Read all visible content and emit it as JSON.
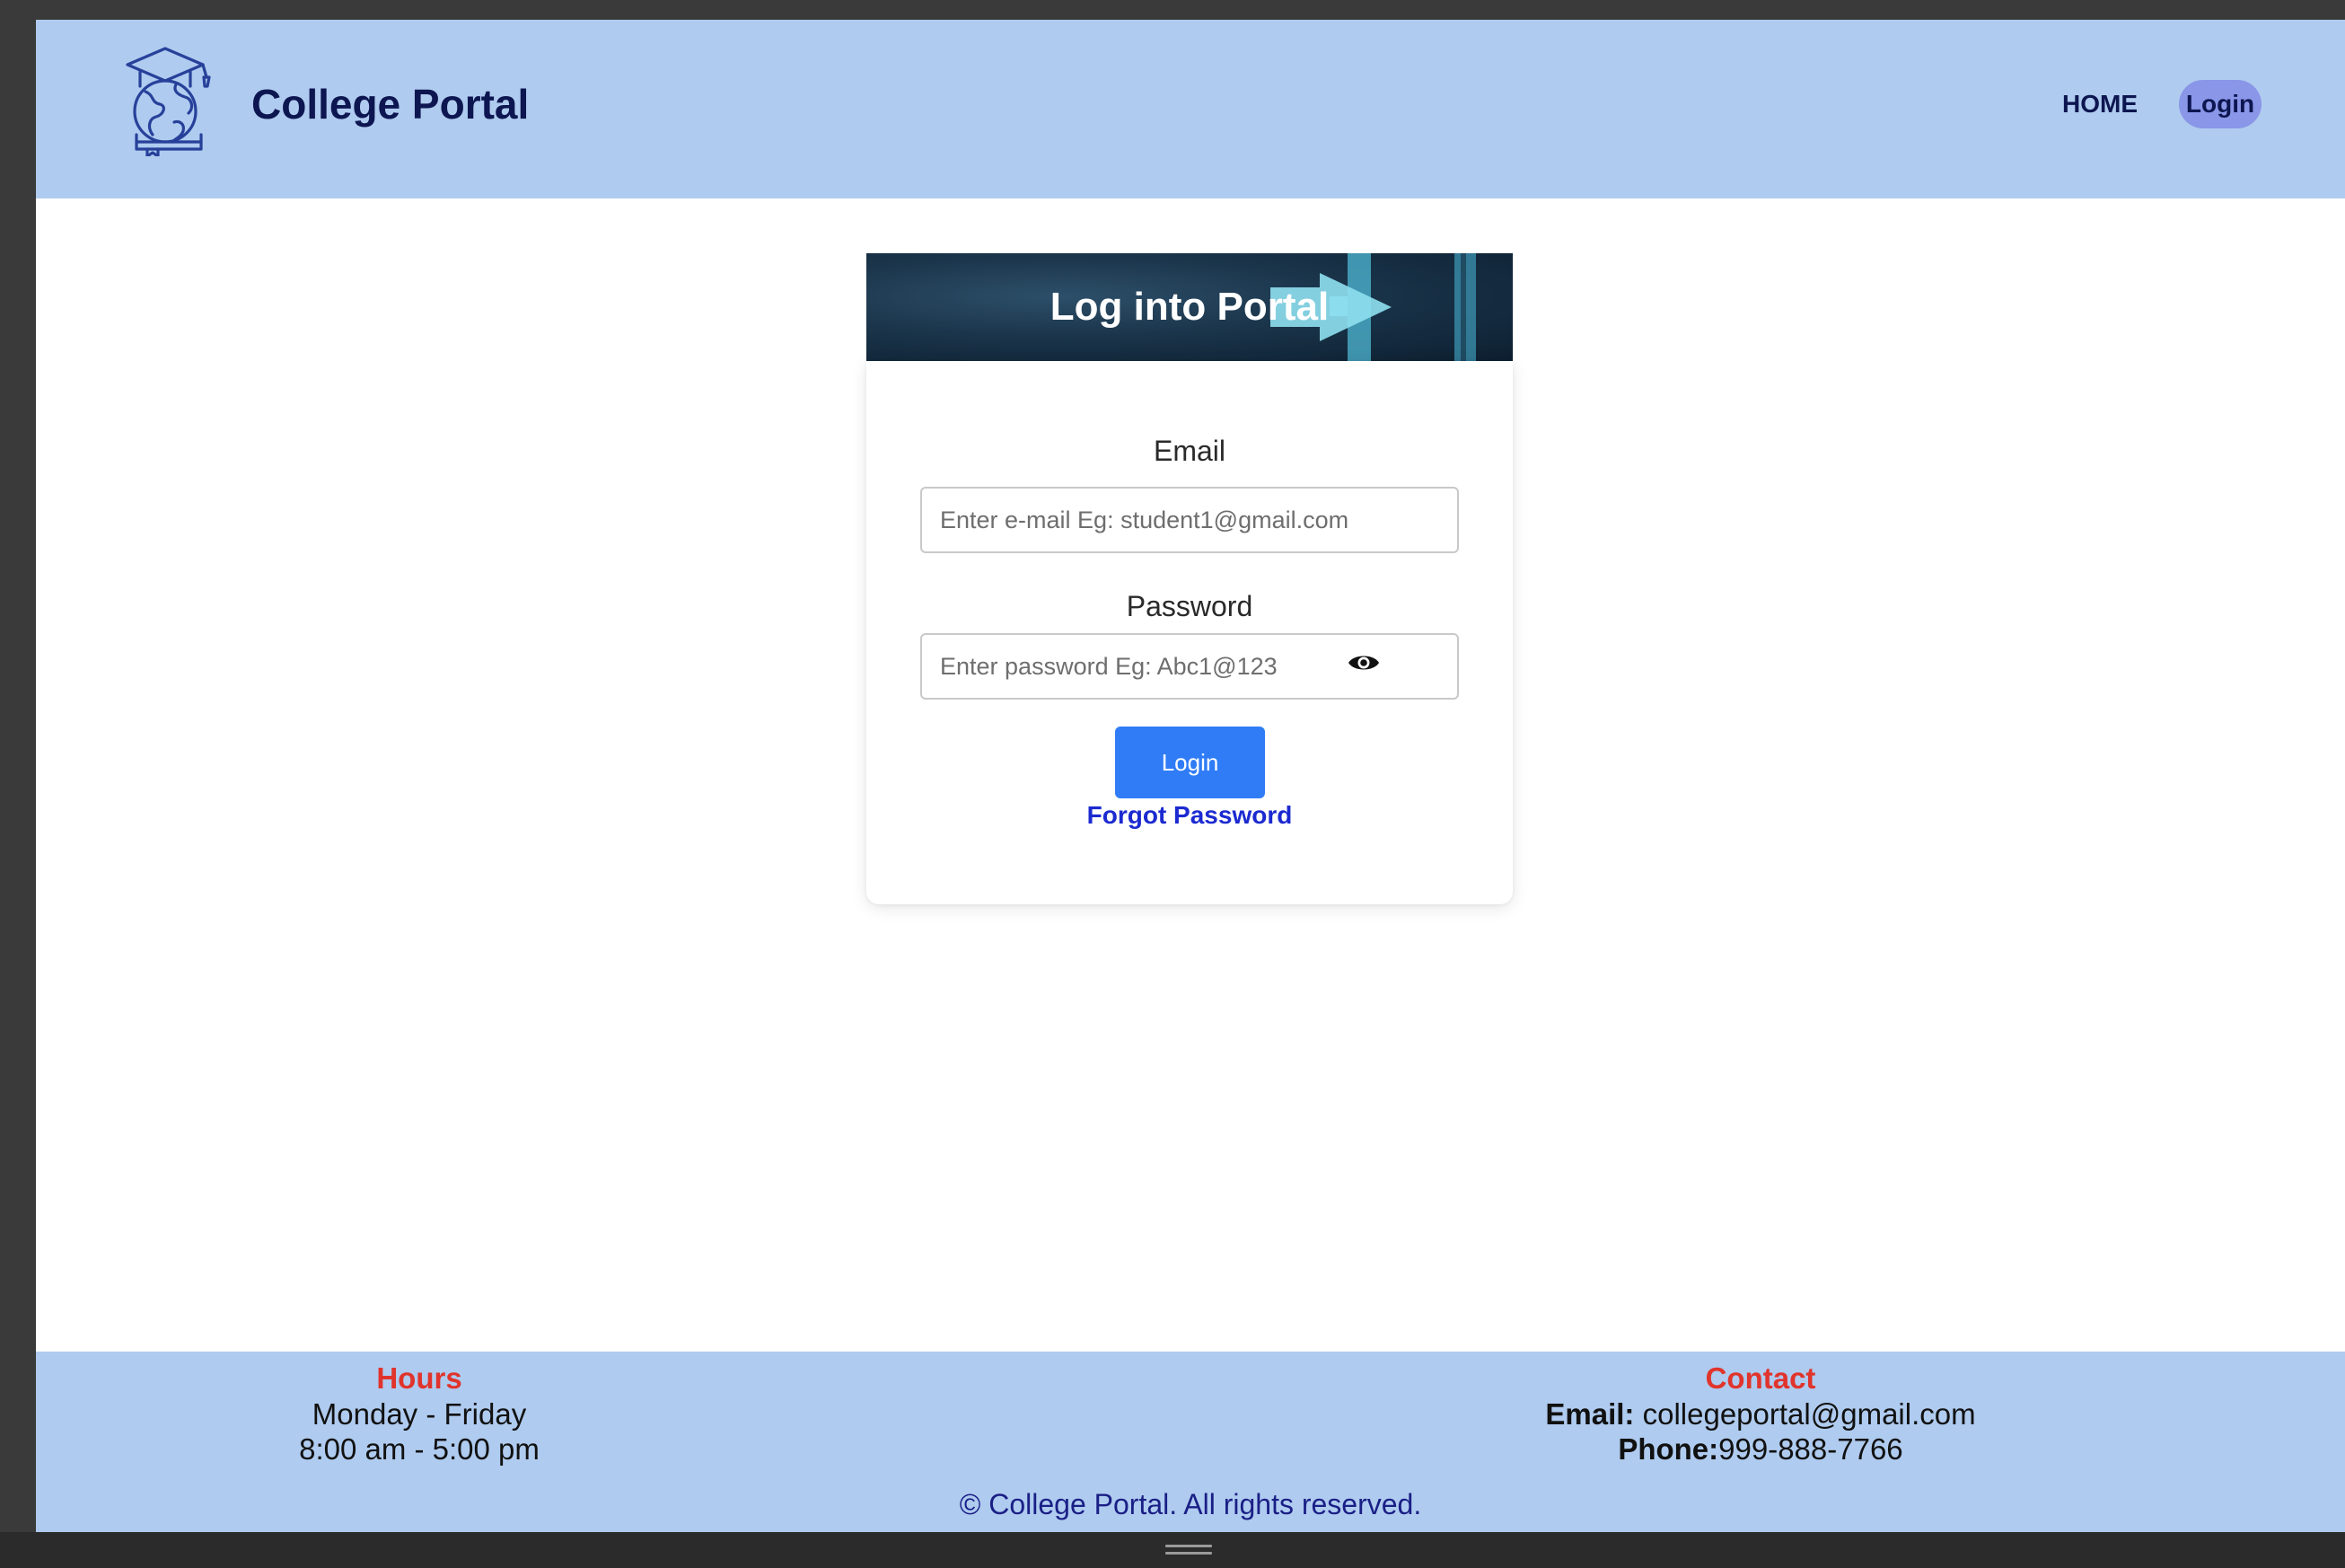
{
  "header": {
    "brand": "College Portal",
    "nav": {
      "home": "HOME",
      "login": "Login"
    }
  },
  "login": {
    "banner_title": "Log into Portal",
    "email_label": "Email",
    "email_placeholder": "Enter e-mail Eg: student1@gmail.com",
    "password_label": "Password",
    "password_placeholder": "Enter password Eg: Abc1@123",
    "submit_label": "Login",
    "forgot_label": "Forgot Password"
  },
  "footer": {
    "hours": {
      "heading": "Hours",
      "days": "Monday - Friday",
      "time": "8:00 am - 5:00 pm"
    },
    "contact": {
      "heading": "Contact",
      "email_key": "Email:",
      "email_value": "collegeportal@gmail.com",
      "phone_key": "Phone:",
      "phone_value": "999-888-7766"
    },
    "copyright": "© College Portal. All rights reserved."
  },
  "colors": {
    "header_bg": "#afcbef",
    "brand_text": "#0d1650",
    "nav_login_pill": "#8a96e8",
    "primary_button": "#2f7cf6",
    "link": "#1b2ad0",
    "footer_heading": "#e0342c"
  },
  "icons": {
    "logo": "graduate-globe-icon",
    "password_toggle": "eye-icon",
    "banner_arrow": "arrow-right-icon"
  }
}
